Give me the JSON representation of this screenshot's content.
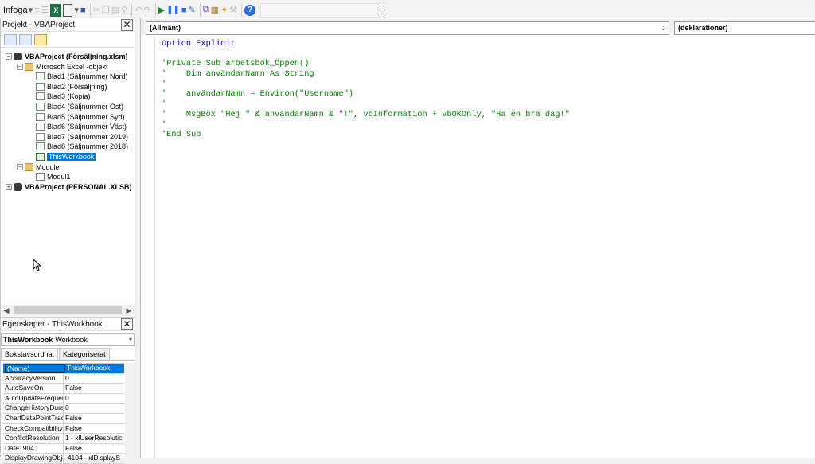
{
  "toolbar": {
    "insert_label": "Infoga"
  },
  "project": {
    "title": "Projekt - VBAProject",
    "tree": [
      {
        "label": "VBAProject (Försäljning.xlsm)",
        "level": 0,
        "kind": "project",
        "expander": "−",
        "bold": true
      },
      {
        "label": "Microsoft Excel -objekt",
        "level": 1,
        "kind": "folder",
        "expander": "−"
      },
      {
        "label": "Blad1 (Säljnummer Nord)",
        "level": 2,
        "kind": "sheet"
      },
      {
        "label": "Blad2 (Försäljning)",
        "level": 2,
        "kind": "sheet"
      },
      {
        "label": "Blad3 (Kopia)",
        "level": 2,
        "kind": "sheet"
      },
      {
        "label": "Blad4 (Säljnummer Öst)",
        "level": 2,
        "kind": "sheet"
      },
      {
        "label": "Blad5 (Säljnummer Syd)",
        "level": 2,
        "kind": "sheet"
      },
      {
        "label": "Blad6 (Säljnummer Väst)",
        "level": 2,
        "kind": "sheet"
      },
      {
        "label": "Blad7 (Säljnummer 2019)",
        "level": 2,
        "kind": "sheet"
      },
      {
        "label": "Blad8 (Säljnummer 2018)",
        "level": 2,
        "kind": "sheet"
      },
      {
        "label": "ThisWorkbook",
        "level": 2,
        "kind": "workbook",
        "selected": true
      },
      {
        "label": "Moduler",
        "level": 1,
        "kind": "folder",
        "expander": "−"
      },
      {
        "label": "Modul1",
        "level": 2,
        "kind": "module"
      },
      {
        "label": "VBAProject (PERSONAL.XLSB)",
        "level": 0,
        "kind": "project",
        "expander": "+",
        "bold": true
      }
    ]
  },
  "properties": {
    "title": "Egenskaper - ThisWorkbook",
    "object_name": "ThisWorkbook",
    "object_type": "Workbook",
    "tabs": [
      "Bokstavsordnat",
      "Kategoriserat"
    ],
    "rows": [
      {
        "name": "(Name)",
        "value": "ThisWorkbook"
      },
      {
        "name": "AccuracyVersion",
        "value": "0"
      },
      {
        "name": "AutoSaveOn",
        "value": "False"
      },
      {
        "name": "AutoUpdateFrequer",
        "value": "0"
      },
      {
        "name": "ChangeHistoryDura",
        "value": "0"
      },
      {
        "name": "ChartDataPointTrac",
        "value": "False"
      },
      {
        "name": "CheckCompatibility",
        "value": "False"
      },
      {
        "name": "ConflictResolution",
        "value": "1 - xlUserResolutic"
      },
      {
        "name": "Date1904",
        "value": "False"
      },
      {
        "name": "DisplayDrawingObje",
        "value": "-4104 - xlDisplayS"
      }
    ]
  },
  "code_window": {
    "object_combo": "(Allmänt)",
    "procedure_combo": "(deklarationer)",
    "lines": [
      {
        "text": "Option Explicit",
        "style": "kw"
      },
      {
        "text": "",
        "style": "plain"
      },
      {
        "text": "'Private Sub arbetsbok_Öppen()",
        "style": "cm"
      },
      {
        "text": "'    Dim användarNamn As String",
        "style": "cm"
      },
      {
        "text": "'",
        "style": "cm"
      },
      {
        "text": "'    användarNamn = Environ(\"Username\")",
        "style": "cm"
      },
      {
        "text": "'",
        "style": "cm"
      },
      {
        "text": "'    MsgBox \"Hej \" & användarNamn & \"!\", vbInformation + vbOKOnly, \"Ha en bra dag!\"",
        "style": "cm"
      },
      {
        "text": "'",
        "style": "cm"
      },
      {
        "text": "'End Sub",
        "style": "cm"
      }
    ]
  }
}
